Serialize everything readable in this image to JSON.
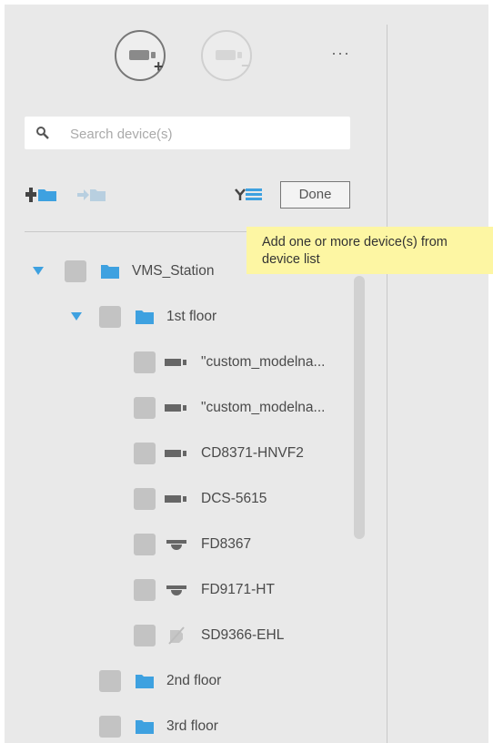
{
  "header": {
    "add_camera": {
      "icon": "add-camera-icon",
      "sign": "+"
    },
    "remove_camera": {
      "icon": "remove-camera-icon",
      "sign": "−"
    },
    "more": "···"
  },
  "search": {
    "placeholder": "Search device(s)",
    "value": "",
    "icon": "search-icon"
  },
  "toolbar": {
    "add_folder_icon": "add-folder-icon",
    "move_to_folder_icon": "move-to-folder-icon",
    "import_list_icon": "import-device-list-icon",
    "done_label": "Done"
  },
  "tooltip": {
    "line1": "Add one or more device(s) from",
    "line2": "device list"
  },
  "tree": {
    "root": {
      "label": "VMS_Station",
      "expanded": true
    },
    "floor1": {
      "label": "1st floor",
      "expanded": true
    },
    "devices": [
      {
        "label": "\"custom_modelna...",
        "type": "bullet-camera"
      },
      {
        "label": "\"custom_modelna...",
        "type": "bullet-camera"
      },
      {
        "label": "CD8371-HNVF2",
        "type": "bullet-camera"
      },
      {
        "label": "DCS-5615",
        "type": "bullet-camera"
      },
      {
        "label": "FD8367",
        "type": "dome-camera"
      },
      {
        "label": "FD9171-HT",
        "type": "dome-camera"
      },
      {
        "label": "SD9366-EHL",
        "type": "disconnected-camera"
      }
    ],
    "floor2": {
      "label": "2nd floor"
    },
    "floor3": {
      "label": "3rd floor"
    }
  },
  "colors": {
    "accent": "#3ea1e0",
    "tooltip_bg": "#fdf6a3",
    "panel_bg": "#e9e9e9"
  }
}
